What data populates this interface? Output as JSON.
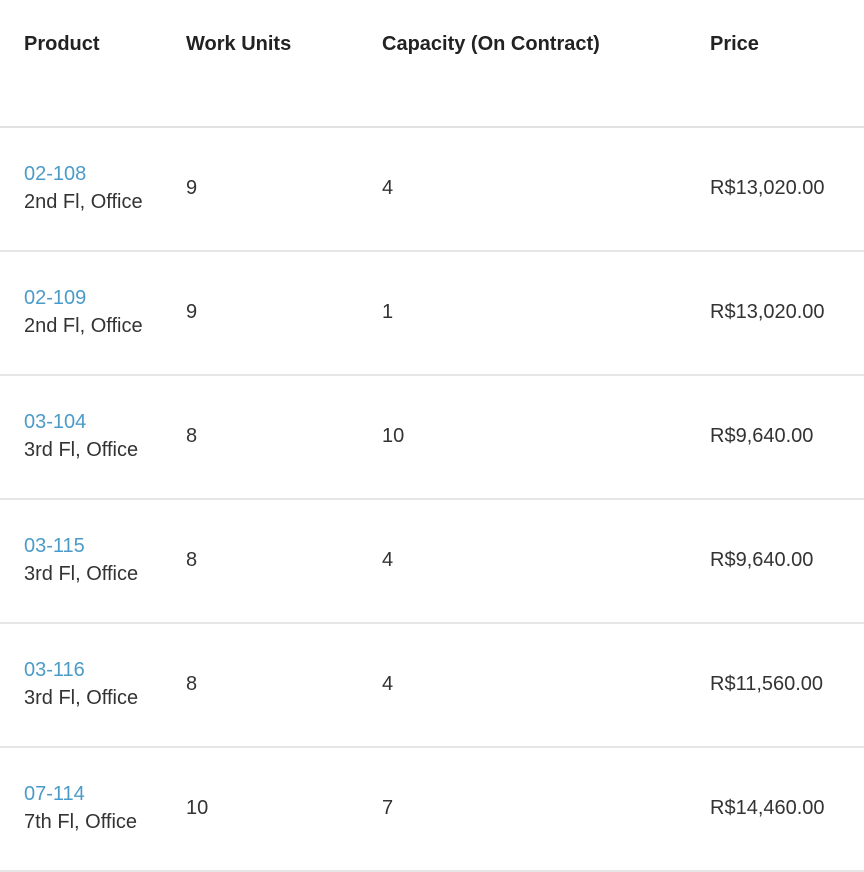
{
  "headers": {
    "product": "Product",
    "work_units": "Work Units",
    "capacity": "Capacity (On Contract)",
    "price": "Price"
  },
  "rows": [
    {
      "code": "02-108",
      "location": "2nd Fl, Office",
      "work_units": "9",
      "capacity": "4",
      "price": "R$13,020.00"
    },
    {
      "code": "02-109",
      "location": "2nd Fl, Office",
      "work_units": "9",
      "capacity": "1",
      "price": "R$13,020.00"
    },
    {
      "code": "03-104",
      "location": "3rd Fl, Office",
      "work_units": "8",
      "capacity": "10",
      "price": "R$9,640.00"
    },
    {
      "code": "03-115",
      "location": "3rd Fl, Office",
      "work_units": "8",
      "capacity": "4",
      "price": "R$9,640.00"
    },
    {
      "code": "03-116",
      "location": "3rd Fl, Office",
      "work_units": "8",
      "capacity": "4",
      "price": "R$11,560.00"
    },
    {
      "code": "07-114",
      "location": "7th Fl, Office",
      "work_units": "10",
      "capacity": "7",
      "price": "R$14,460.00"
    }
  ]
}
